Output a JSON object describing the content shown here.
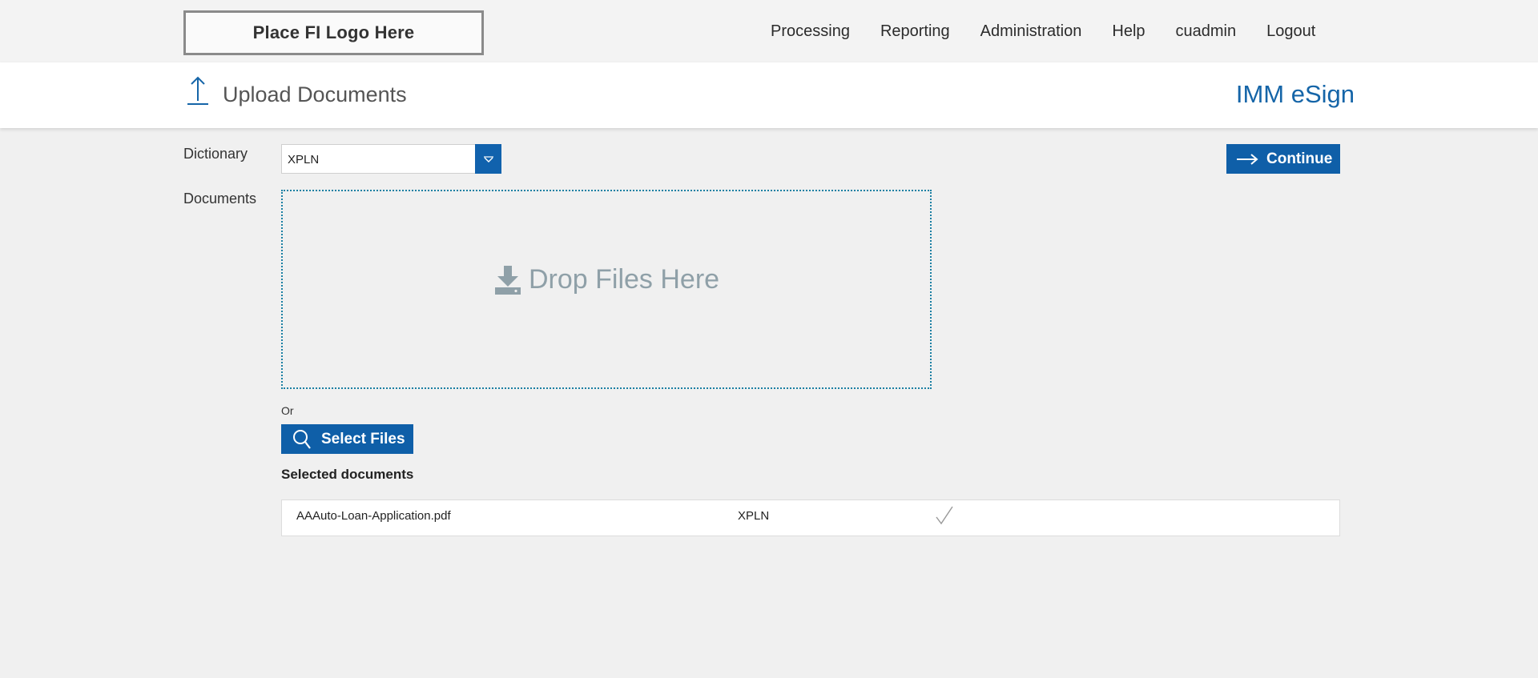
{
  "header": {
    "logo_text": "Place FI Logo Here",
    "nav": [
      "Processing",
      "Reporting",
      "Administration",
      "Help",
      "cuadmin",
      "Logout"
    ]
  },
  "page": {
    "title": "Upload Documents",
    "brand": "IMM eSign",
    "title_icon": "upload-arrow-icon"
  },
  "form": {
    "dictionary_label": "Dictionary",
    "dictionary_value": "XPLN",
    "documents_label": "Documents",
    "drop_text": "Drop Files Here",
    "or_text": "Or",
    "select_files_label": "Select Files",
    "continue_label": "Continue"
  },
  "selected": {
    "heading": "Selected documents",
    "rows": [
      {
        "file": "AAAuto-Loan-Application.pdf",
        "dictionary": "XPLN",
        "status_icon": "checkmark-icon"
      }
    ]
  },
  "colors": {
    "accent": "#0f5fa8",
    "brand_text": "#1565a8",
    "drop_border": "#1a7fa3",
    "drop_text": "#8fa0a8"
  }
}
